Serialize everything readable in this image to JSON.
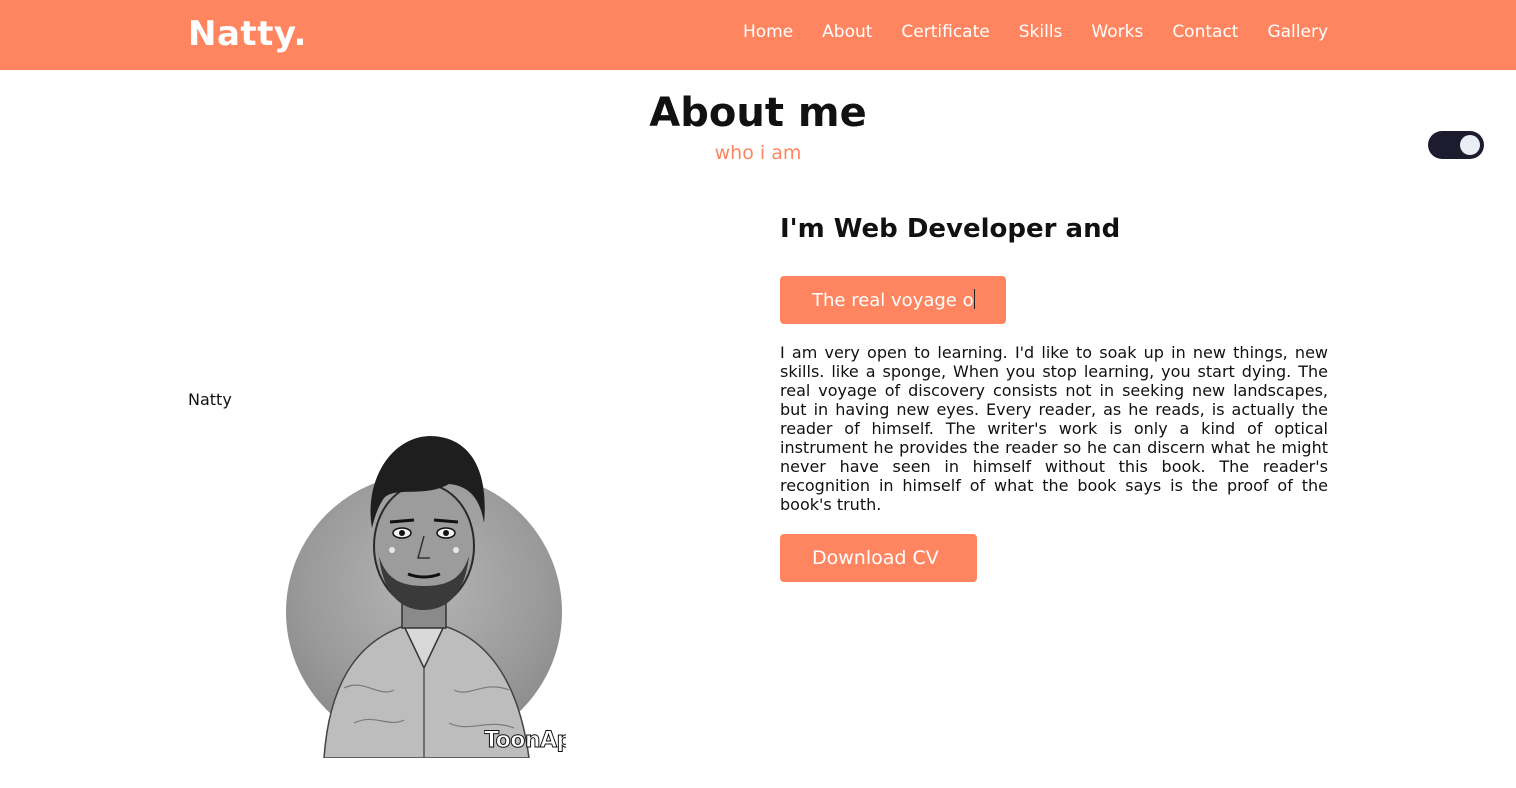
{
  "nav": {
    "logo": "Natty",
    "logo_dot": ".",
    "items": [
      {
        "label": "Home"
      },
      {
        "label": "About"
      },
      {
        "label": "Certificate"
      },
      {
        "label": "Skills"
      },
      {
        "label": "Works"
      },
      {
        "label": "Contact"
      },
      {
        "label": "Gallery"
      }
    ]
  },
  "theme_toggle": {
    "state": "on",
    "icon": "toggle-switch"
  },
  "section": {
    "title": "About me",
    "subtitle": "who i am"
  },
  "profile": {
    "image_alt_text": "Natty",
    "watermark": "ToonApp"
  },
  "about": {
    "headline": "I'm Web Developer and",
    "typing_text": "The real voyage o",
    "bio": "I am very open to learning. I'd like to soak up in new things, new skills. like a sponge, When you stop learning, you start dying. The real voyage of discovery consists not in seeking new landscapes, but in having new eyes. Every reader, as he reads, is actually the reader of himself. The writer's work is only a kind of optical instrument he provides the reader so he can discern what he might never have seen in himself without this book. The reader's recognition in himself of what the book says is the proof of the book's truth.",
    "cv_button": "Download CV"
  },
  "colors": {
    "accent": "#ff8560",
    "toggle_bg": "#1c1c2e",
    "text": "#111111"
  }
}
